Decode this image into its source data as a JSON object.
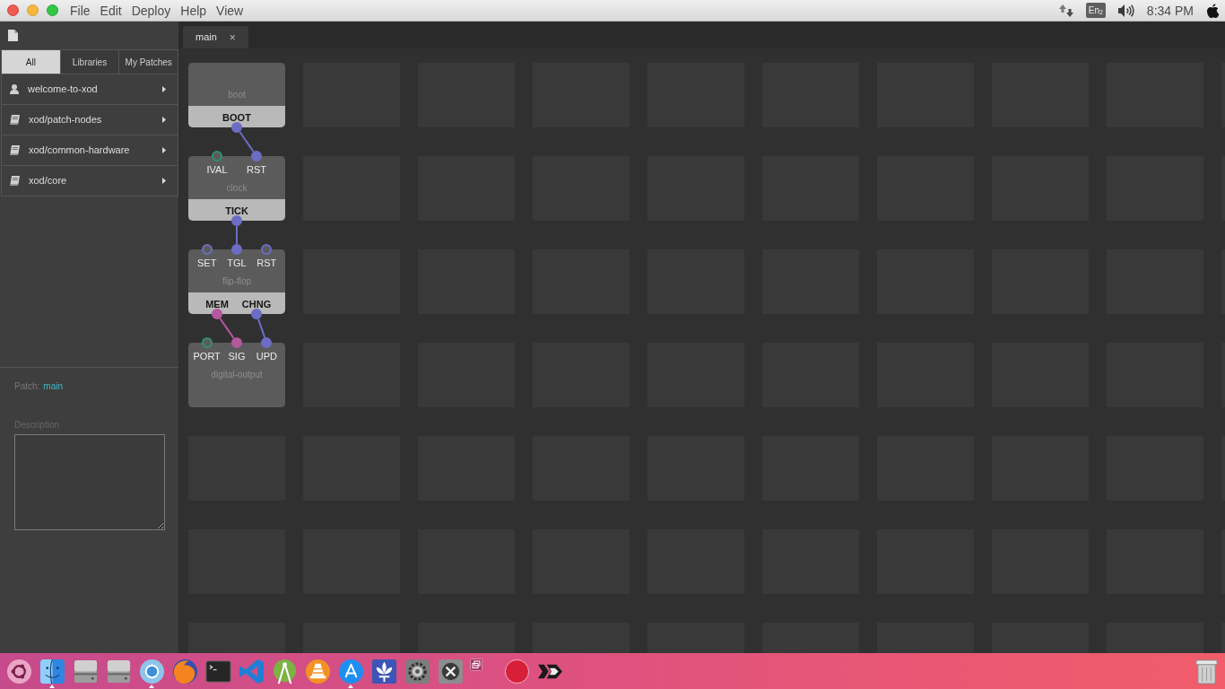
{
  "menu_bar": {
    "menus": [
      "File",
      "Edit",
      "Deploy",
      "Help",
      "View"
    ],
    "keyboard_layout": "En$_{2}$",
    "clock": "8:34 PM"
  },
  "sidebar": {
    "tabs": [
      {
        "label": "All",
        "selected": true
      },
      {
        "label": "Libraries",
        "selected": false
      },
      {
        "label": "My Patches",
        "selected": false
      }
    ],
    "items": [
      {
        "label": "welcome-to-xod",
        "kind": "project",
        "expanded": false
      },
      {
        "label": "xod/patch-nodes",
        "kind": "library",
        "expanded": false
      },
      {
        "label": "xod/common-hardware",
        "kind": "library",
        "expanded": false
      },
      {
        "label": "xod/core",
        "kind": "library",
        "expanded": false
      }
    ],
    "patch": {
      "label": "Patch:",
      "name": "main"
    },
    "description": {
      "label": "Description"
    }
  },
  "editor": {
    "tabs": [
      {
        "label": "main",
        "close": "×",
        "selected": true
      }
    ],
    "nodes": [
      {
        "title": "boot",
        "outputs": [
          {
            "label": "BOOT",
            "color": "#6d6dc6",
            "connected": true
          }
        ]
      },
      {
        "title": "clock",
        "inputs": [
          {
            "label": "IVAL",
            "color": "#2f9470",
            "connected": false
          },
          {
            "label": "RST",
            "color": "#6d6dc6",
            "connected": true
          }
        ],
        "outputs": [
          {
            "label": "TICK",
            "color": "#6d6dc6",
            "connected": true
          }
        ]
      },
      {
        "title": "flip-flop",
        "inputs": [
          {
            "label": "SET",
            "color": "#6d6dc6",
            "connected": false
          },
          {
            "label": "TGL",
            "color": "#6d6dc6",
            "connected": true
          },
          {
            "label": "RST",
            "color": "#6d6dc6",
            "connected": false
          }
        ],
        "outputs": [
          {
            "label": "MEM",
            "color": "#b4589f",
            "connected": true
          },
          {
            "label": "CHNG",
            "color": "#6d6dc6",
            "connected": true
          }
        ]
      },
      {
        "title": "digital-output",
        "inputs": [
          {
            "label": "PORT",
            "color": "#2f9470",
            "connected": false
          },
          {
            "label": "SIG",
            "color": "#b4589f",
            "connected": true
          },
          {
            "label": "UPD",
            "color": "#6d6dc6",
            "connected": true
          }
        ]
      }
    ]
  },
  "dock": {
    "items": [
      {
        "kind": "ring",
        "running": false
      },
      {
        "kind": "face",
        "running": true
      },
      {
        "kind": "drive",
        "running": false
      },
      {
        "kind": "drive",
        "running": false
      },
      {
        "kind": "globe",
        "running": true
      },
      {
        "kind": "fox",
        "running": false
      },
      {
        "kind": "terminal",
        "running": false
      },
      {
        "kind": "ribbon",
        "running": false
      },
      {
        "kind": "robot",
        "running": false
      },
      {
        "kind": "cone",
        "running": false
      },
      {
        "kind": "store",
        "running": true
      },
      {
        "kind": "fleur",
        "running": false
      },
      {
        "kind": "gear",
        "running": false
      },
      {
        "kind": "tools",
        "running": false
      },
      {
        "kind": "window",
        "running": false
      },
      {
        "kind": "disc",
        "running": false
      },
      {
        "kind": "chevron",
        "running": false
      },
      {
        "kind": "trash",
        "running": false
      }
    ]
  }
}
